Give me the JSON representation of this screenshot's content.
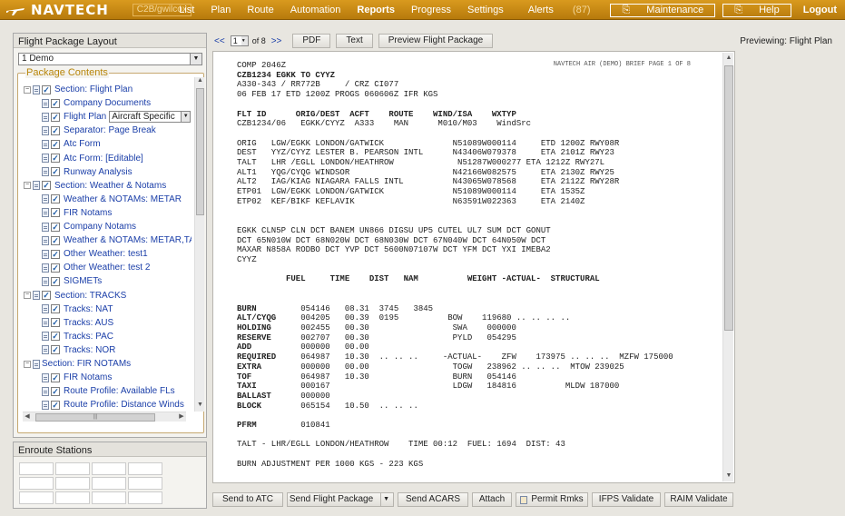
{
  "header": {
    "logo_text": "NAVTECH",
    "user": "C2B/gwilcox",
    "nav": [
      {
        "label": "List"
      },
      {
        "label": "Plan"
      },
      {
        "label": "Route"
      },
      {
        "label": "Automation"
      },
      {
        "label": "Reports"
      },
      {
        "label": "Progress"
      },
      {
        "label": "Settings"
      }
    ],
    "alerts_label": "Alerts",
    "alerts_count": "(87)",
    "maintenance_label": "Maintenance",
    "help_label": "Help",
    "logout_label": "Logout"
  },
  "left_panel": {
    "title": "Flight Package Layout",
    "layout_select": "1 Demo",
    "contents_legend": "Package Contents",
    "tree": [
      {
        "label": "Section: Flight Plan",
        "level": 0,
        "section": true
      },
      {
        "label": "Company Documents",
        "level": 1
      },
      {
        "label": "Flight Plan",
        "level": 1,
        "dropdown": "Aircraft Specific"
      },
      {
        "label": "Separator: Page Break",
        "level": 1
      },
      {
        "label": "Atc Form",
        "level": 1
      },
      {
        "label": "Atc Form: [Editable]",
        "level": 1
      },
      {
        "label": "Runway Analysis",
        "level": 1
      },
      {
        "label": "Section: Weather & Notams",
        "level": 0,
        "section": true
      },
      {
        "label": "Weather & NOTAMs: METAR",
        "level": 1
      },
      {
        "label": "FIR Notams",
        "level": 1
      },
      {
        "label": "Company Notams",
        "level": 1
      },
      {
        "label": "Weather & NOTAMs: METAR,TAF,I",
        "level": 1
      },
      {
        "label": "Other Weather: test1",
        "level": 1
      },
      {
        "label": "Other Weather: test 2",
        "level": 1
      },
      {
        "label": "SIGMETs",
        "level": 1
      },
      {
        "label": "Section: TRACKS",
        "level": 0,
        "section": true
      },
      {
        "label": "Tracks: NAT",
        "level": 1
      },
      {
        "label": "Tracks: AUS",
        "level": 1
      },
      {
        "label": "Tracks: PAC",
        "level": 1
      },
      {
        "label": "Tracks: NOR",
        "level": 1
      },
      {
        "label": "Section: FIR NOTAMs",
        "level": 0,
        "section": true,
        "nocheck": true
      },
      {
        "label": "FIR Notams",
        "level": 1
      },
      {
        "label": "Route Profile: Available FLs",
        "level": 1
      },
      {
        "label": "Route Profile: Distance Winds",
        "level": 1
      }
    ],
    "enroute_title": "Enroute Stations"
  },
  "toolbar": {
    "prev": "<<",
    "page": "1",
    "of": "of 8",
    "next": ">>",
    "pdf": "PDF",
    "text": "Text",
    "preview": "Preview Flight Package",
    "previewing": "Previewing: Flight Plan"
  },
  "document": {
    "page_header": "NAVTECH AIR (DEMO) BRIEF PAGE 1 OF 8",
    "lines": [
      "COMP 2046Z",
      "**CZB1234 EGKK TO CYYZ",
      "A330-343 / RR772B     / CRZ CI077",
      "06 FEB 17 ETD 1200Z PROGS 060606Z IFR KGS",
      "",
      "**FLT ID      ORIG/DEST  ACFT    ROUTE    WIND/ISA    WXTYP",
      "CZB1234/06   EGKK/CYYZ  A333    MAN      M010/M03    WindSrc",
      "",
      "ORIG   LGW/EGKK LONDON/GATWICK              N51089W000114     ETD 1200Z RWY08R",
      "DEST   YYZ/CYYZ LESTER B. PEARSON INTL      N43406W079378     ETA 2101Z RWY23",
      "TALT   LHR /EGLL LONDON/HEATHROW             N51287W000277 ETA 1212Z RWY27L",
      "ALT1   YQG/CYQG WINDSOR                     N42166W082575     ETA 2130Z RWY25",
      "ALT2   IAG/KIAG NIAGARA FALLS INTL          N43065W078568     ETA 2112Z RWY28R",
      "ETP01  LGW/EGKK LONDON/GATWICK              N51089W000114     ETA 1535Z",
      "ETP02  KEF/BIKF KEFLAVIK                    N63591W022363     ETA 2140Z",
      "",
      "",
      "EGKK CLN5P CLN DCT BANEM UN866 DIGSU UP5 CUTEL UL7 SUM DCT GONUT",
      "DCT 65N010W DCT 68N020W DCT 68N030W DCT 67N040W DCT 64N050W DCT",
      "MAXAR N858A RODBO DCT YVP DCT 5600N07107W DCT YFM DCT YXI IMEBA2",
      "CYYZ",
      "",
      "**          FUEL     TIME    DIST   NAM          WEIGHT -ACTUAL-  STRUCTURAL",
      "",
      "",
      "**BURN         054146   08.31  3745   3845",
      "**ALT/CYQG     004205   00.39  0195          BOW    119680 .. .. .. ..",
      "**HOLDING      002455   00.30                 SWA    000000",
      "**RESERVE      002707   00.30                 PYLD   054295",
      "**ADD          000000   00.00",
      "**REQUIRED     064987   10.30  .. .. ..     -ACTUAL-    ZFW    173975 .. .. ..  MZFW 175000",
      "**EXTRA        000000   00.00                 TOGW   238962 .. .. ..  MTOW 239025",
      "**TOF          064987   10.30                 BURN   054146",
      "**TAXI         000167                         LDGW   184816          MLDW 187000",
      "**BALLAST      000000",
      "**BLOCK        065154   10.50  .. .. ..",
      "",
      "**PFRM         010841",
      "",
      "TALT - LHR/EGLL LONDON/HEATHROW    TIME 00:12  FUEL: 1694  DIST: 43",
      "",
      "BURN ADJUSTMENT PER 1000 KGS - 223 KGS"
    ]
  },
  "bottom_buttons": {
    "send_atc": "Send to ATC",
    "send_package": "Send Flight Package",
    "send_acars": "Send ACARS",
    "attach": "Attach",
    "permit": "Permit Rmks",
    "ifps": "IFPS Validate",
    "raim": "RAIM Validate"
  }
}
